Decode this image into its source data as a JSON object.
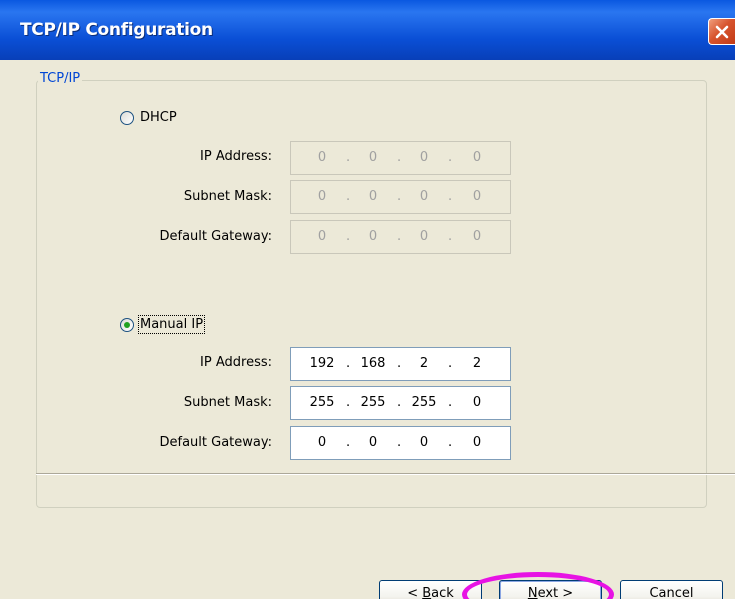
{
  "window": {
    "title": "TCP/IP Configuration"
  },
  "group": {
    "label": "TCP/IP"
  },
  "dhcp": {
    "label": "DHCP",
    "selected": false,
    "fields": [
      {
        "label": "IP Address:",
        "octets": [
          "0",
          "0",
          "0",
          "0"
        ]
      },
      {
        "label": "Subnet Mask:",
        "octets": [
          "0",
          "0",
          "0",
          "0"
        ]
      },
      {
        "label": "Default Gateway:",
        "octets": [
          "0",
          "0",
          "0",
          "0"
        ]
      }
    ]
  },
  "manual": {
    "label": "Manual IP",
    "selected": true,
    "fields": [
      {
        "label": "IP Address:",
        "octets": [
          "192",
          "168",
          "2",
          "2"
        ]
      },
      {
        "label": "Subnet Mask:",
        "octets": [
          "255",
          "255",
          "255",
          "0"
        ]
      },
      {
        "label": "Default Gateway:",
        "octets": [
          "0",
          "0",
          "0",
          "0"
        ]
      }
    ]
  },
  "buttons": {
    "back": {
      "prefix": "< ",
      "mnemonic": "B",
      "rest": "ack"
    },
    "next": {
      "mnemonic": "N",
      "rest": "ext >"
    },
    "cancel": {
      "label": "Cancel"
    }
  },
  "colors": {
    "titlebar": "#0a4fd6",
    "window_bg": "#ece9d8",
    "group_label": "#0046d5",
    "highlight": "#e713e4"
  },
  "icons": {
    "close": "close-icon"
  }
}
